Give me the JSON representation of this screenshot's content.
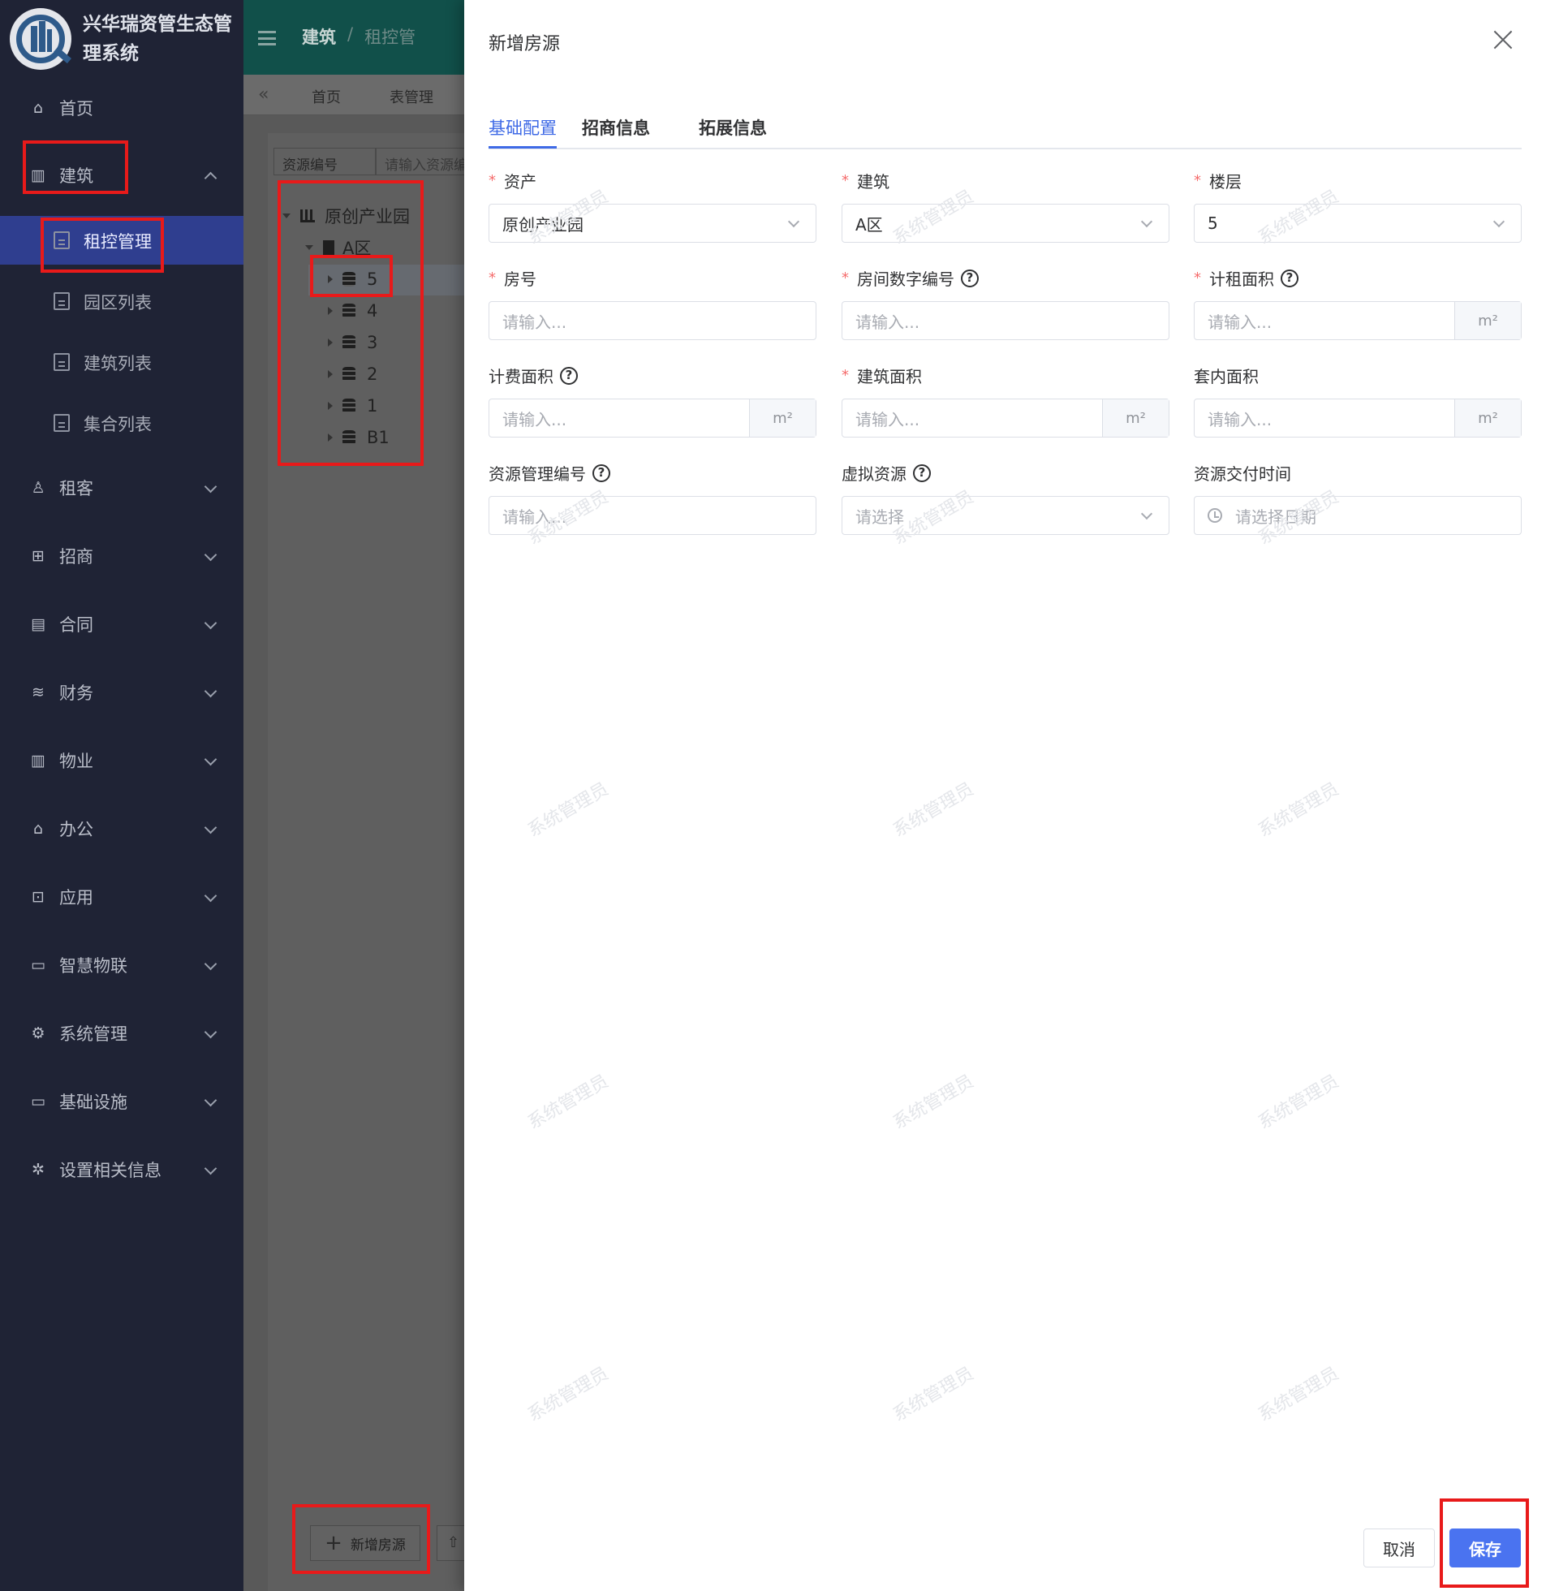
{
  "app": {
    "title": "兴华瑞资管生态管理系统"
  },
  "sidebar": {
    "items": [
      {
        "label": "首页",
        "icon": "home-icon"
      },
      {
        "label": "建筑",
        "icon": "building-icon",
        "expanded": true
      },
      {
        "label": "租客",
        "icon": "user-icon"
      },
      {
        "label": "招商",
        "icon": "briefcase-icon"
      },
      {
        "label": "合同",
        "icon": "document-icon"
      },
      {
        "label": "财务",
        "icon": "coins-icon"
      },
      {
        "label": "物业",
        "icon": "building-icon"
      },
      {
        "label": "办公",
        "icon": "house-icon"
      },
      {
        "label": "应用",
        "icon": "bag-icon"
      },
      {
        "label": "智慧物联",
        "icon": "monitor-icon"
      },
      {
        "label": "系统管理",
        "icon": "gear-icon"
      },
      {
        "label": "基础设施",
        "icon": "monitor-icon"
      },
      {
        "label": "设置相关信息",
        "icon": "aperture-icon"
      }
    ],
    "sub_items": [
      {
        "label": "租控管理",
        "active": true
      },
      {
        "label": "园区列表"
      },
      {
        "label": "建筑列表"
      },
      {
        "label": "集合列表"
      }
    ]
  },
  "header": {
    "breadcrumb_root": "建筑",
    "breadcrumb_sep": "/",
    "breadcrumb_current": "租控管"
  },
  "tabbar": {
    "home": "首页",
    "table": "表管理"
  },
  "filter": {
    "select_value": "资源编号",
    "input_placeholder": "请输入资源编"
  },
  "tree": {
    "root": "原创产业园",
    "zone": "A区",
    "floors": [
      "5",
      "4",
      "3",
      "2",
      "1",
      "B1"
    ]
  },
  "buttons": {
    "add_room": "新增房源"
  },
  "drawer": {
    "title": "新增房源",
    "tabs": [
      "基础配置",
      "招商信息",
      "拓展信息"
    ],
    "fields": {
      "asset": {
        "label": "资产",
        "value": "原创产业园"
      },
      "building": {
        "label": "建筑",
        "value": "A区"
      },
      "floor": {
        "label": "楼层",
        "value": "5"
      },
      "room_no": {
        "label": "房号",
        "placeholder": "请输入..."
      },
      "room_digit_no": {
        "label": "房间数字编号",
        "placeholder": "请输入..."
      },
      "rent_area": {
        "label": "计租面积",
        "placeholder": "请输入...",
        "unit": "m²"
      },
      "billing_area": {
        "label": "计费面积",
        "placeholder": "请输入...",
        "unit": "m²"
      },
      "building_area": {
        "label": "建筑面积",
        "placeholder": "请输入...",
        "unit": "m²"
      },
      "inner_area": {
        "label": "套内面积",
        "placeholder": "请输入...",
        "unit": "m²"
      },
      "resource_mgmt_no": {
        "label": "资源管理编号",
        "placeholder": "请输入..."
      },
      "virtual_resource": {
        "label": "虚拟资源",
        "placeholder": "请选择"
      },
      "delivery_time": {
        "label": "资源交付时间",
        "placeholder": "请选择日期"
      }
    },
    "required_mark": "*",
    "help_glyph": "?",
    "cancel_label": "取消",
    "save_label": "保存",
    "watermark": "系统管理员"
  },
  "colors": {
    "primary": "#4a73f0",
    "sidebar_bg": "#1f2335",
    "active_menu": "#2f3e8f",
    "required": "#f56c6c",
    "annotation": "#e81a1a"
  }
}
